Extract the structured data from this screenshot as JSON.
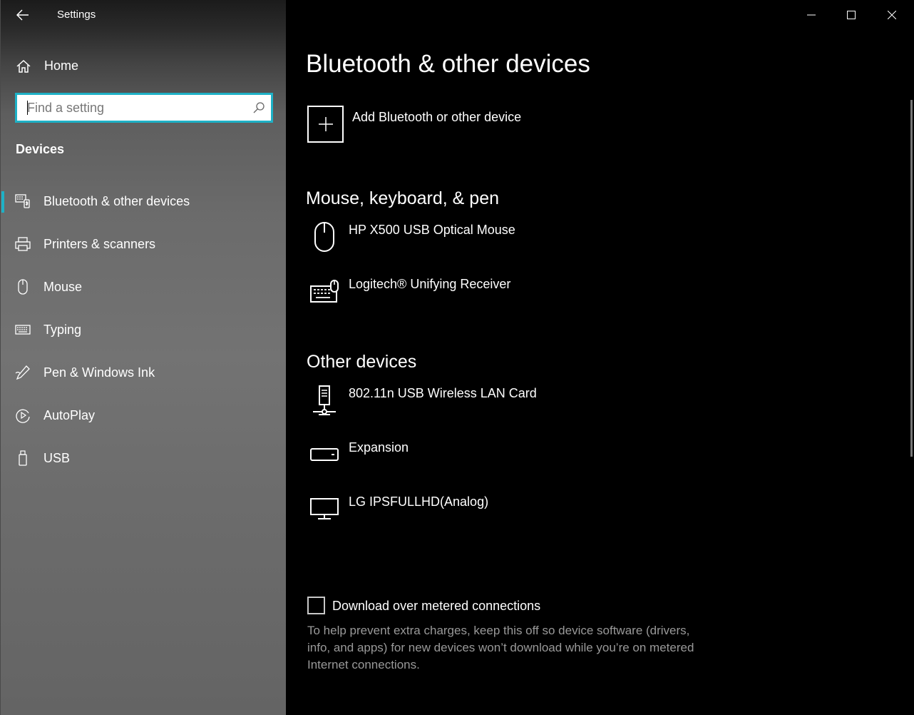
{
  "app": {
    "title": "Settings"
  },
  "sidebar": {
    "home_label": "Home",
    "search_placeholder": "Find a setting",
    "section_label": "Devices",
    "items": [
      {
        "label": "Bluetooth & other devices",
        "icon": "bluetooth-devices-icon",
        "selected": true
      },
      {
        "label": "Printers & scanners",
        "icon": "printer-icon"
      },
      {
        "label": "Mouse",
        "icon": "mouse-icon"
      },
      {
        "label": "Typing",
        "icon": "keyboard-icon"
      },
      {
        "label": "Pen & Windows Ink",
        "icon": "pen-icon"
      },
      {
        "label": "AutoPlay",
        "icon": "autoplay-icon"
      },
      {
        "label": "USB",
        "icon": "usb-icon"
      }
    ]
  },
  "main": {
    "title": "Bluetooth & other devices",
    "add_device_label": "Add Bluetooth or other device",
    "groups": [
      {
        "title": "Mouse, keyboard, & pen",
        "devices": [
          {
            "name": "HP X500 USB Optical Mouse",
            "icon": "mouse-icon"
          },
          {
            "name": "Logitech®  Unifying Receiver",
            "icon": "keyboard-mouse-icon"
          }
        ]
      },
      {
        "title": "Other devices",
        "devices": [
          {
            "name": "802.11n USB Wireless LAN Card",
            "icon": "network-device-icon"
          },
          {
            "name": "Expansion",
            "icon": "drive-icon"
          },
          {
            "name": "LG IPSFULLHD(Analog)",
            "icon": "monitor-icon"
          }
        ]
      }
    ],
    "metered_checkbox_label": "Download over metered connections",
    "metered_checked": false,
    "help_text": "To help prevent extra charges, keep this off so device software (drivers, info, and apps) for new devices won’t download while you’re on metered Internet connections."
  },
  "colors": {
    "accent": "#1eb1c6",
    "main_background": "#000000",
    "help_text": "#999999"
  }
}
